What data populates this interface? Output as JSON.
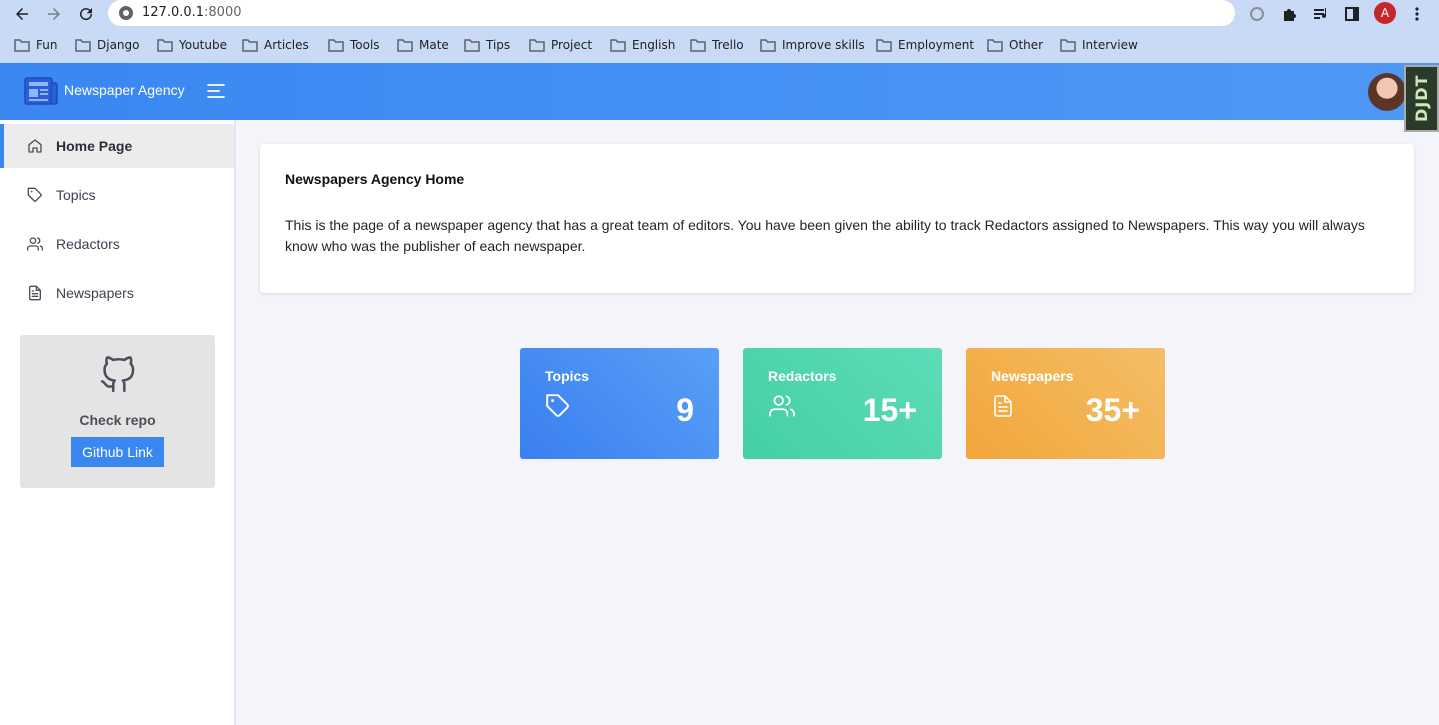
{
  "browser": {
    "url_host": "127.0.0.1",
    "url_port": ":8000",
    "profile_initial": "A",
    "bookmarks": [
      "Fun",
      "Django",
      "Youtube",
      "Articles",
      "Tools",
      "Mate",
      "Tips",
      "Project",
      "English",
      "Trello",
      "Improve skills",
      "Employment",
      "Other",
      "Interview"
    ]
  },
  "header": {
    "brand": "Newspaper Agency",
    "djdt": "DJDT"
  },
  "sidebar": {
    "items": [
      {
        "label": "Home Page",
        "icon": "home-icon",
        "active": true
      },
      {
        "label": "Topics",
        "icon": "tag-icon",
        "active": false
      },
      {
        "label": "Redactors",
        "icon": "users-icon",
        "active": false
      },
      {
        "label": "Newspapers",
        "icon": "file-text-icon",
        "active": false
      }
    ],
    "repo": {
      "title": "Check repo",
      "button": "Github Link"
    }
  },
  "main": {
    "title": "Newspapers Agency Home",
    "text": "This is the page of a newspaper agency that has a great team of editors. You have been given the ability to track Redactors assigned to Newspapers. This way you will always know who was the publisher of each newspaper.",
    "stats": [
      {
        "label": "Topics",
        "value": "9",
        "icon": "tag-icon"
      },
      {
        "label": "Redactors",
        "value": "15+",
        "icon": "users-icon"
      },
      {
        "label": "Newspapers",
        "value": "35+",
        "icon": "file-text-icon"
      }
    ]
  },
  "colors": {
    "primary": "#3a87f2",
    "topics": "#3a7ff0",
    "redactors": "#45cfa5",
    "newspapers": "#f2a63b"
  }
}
